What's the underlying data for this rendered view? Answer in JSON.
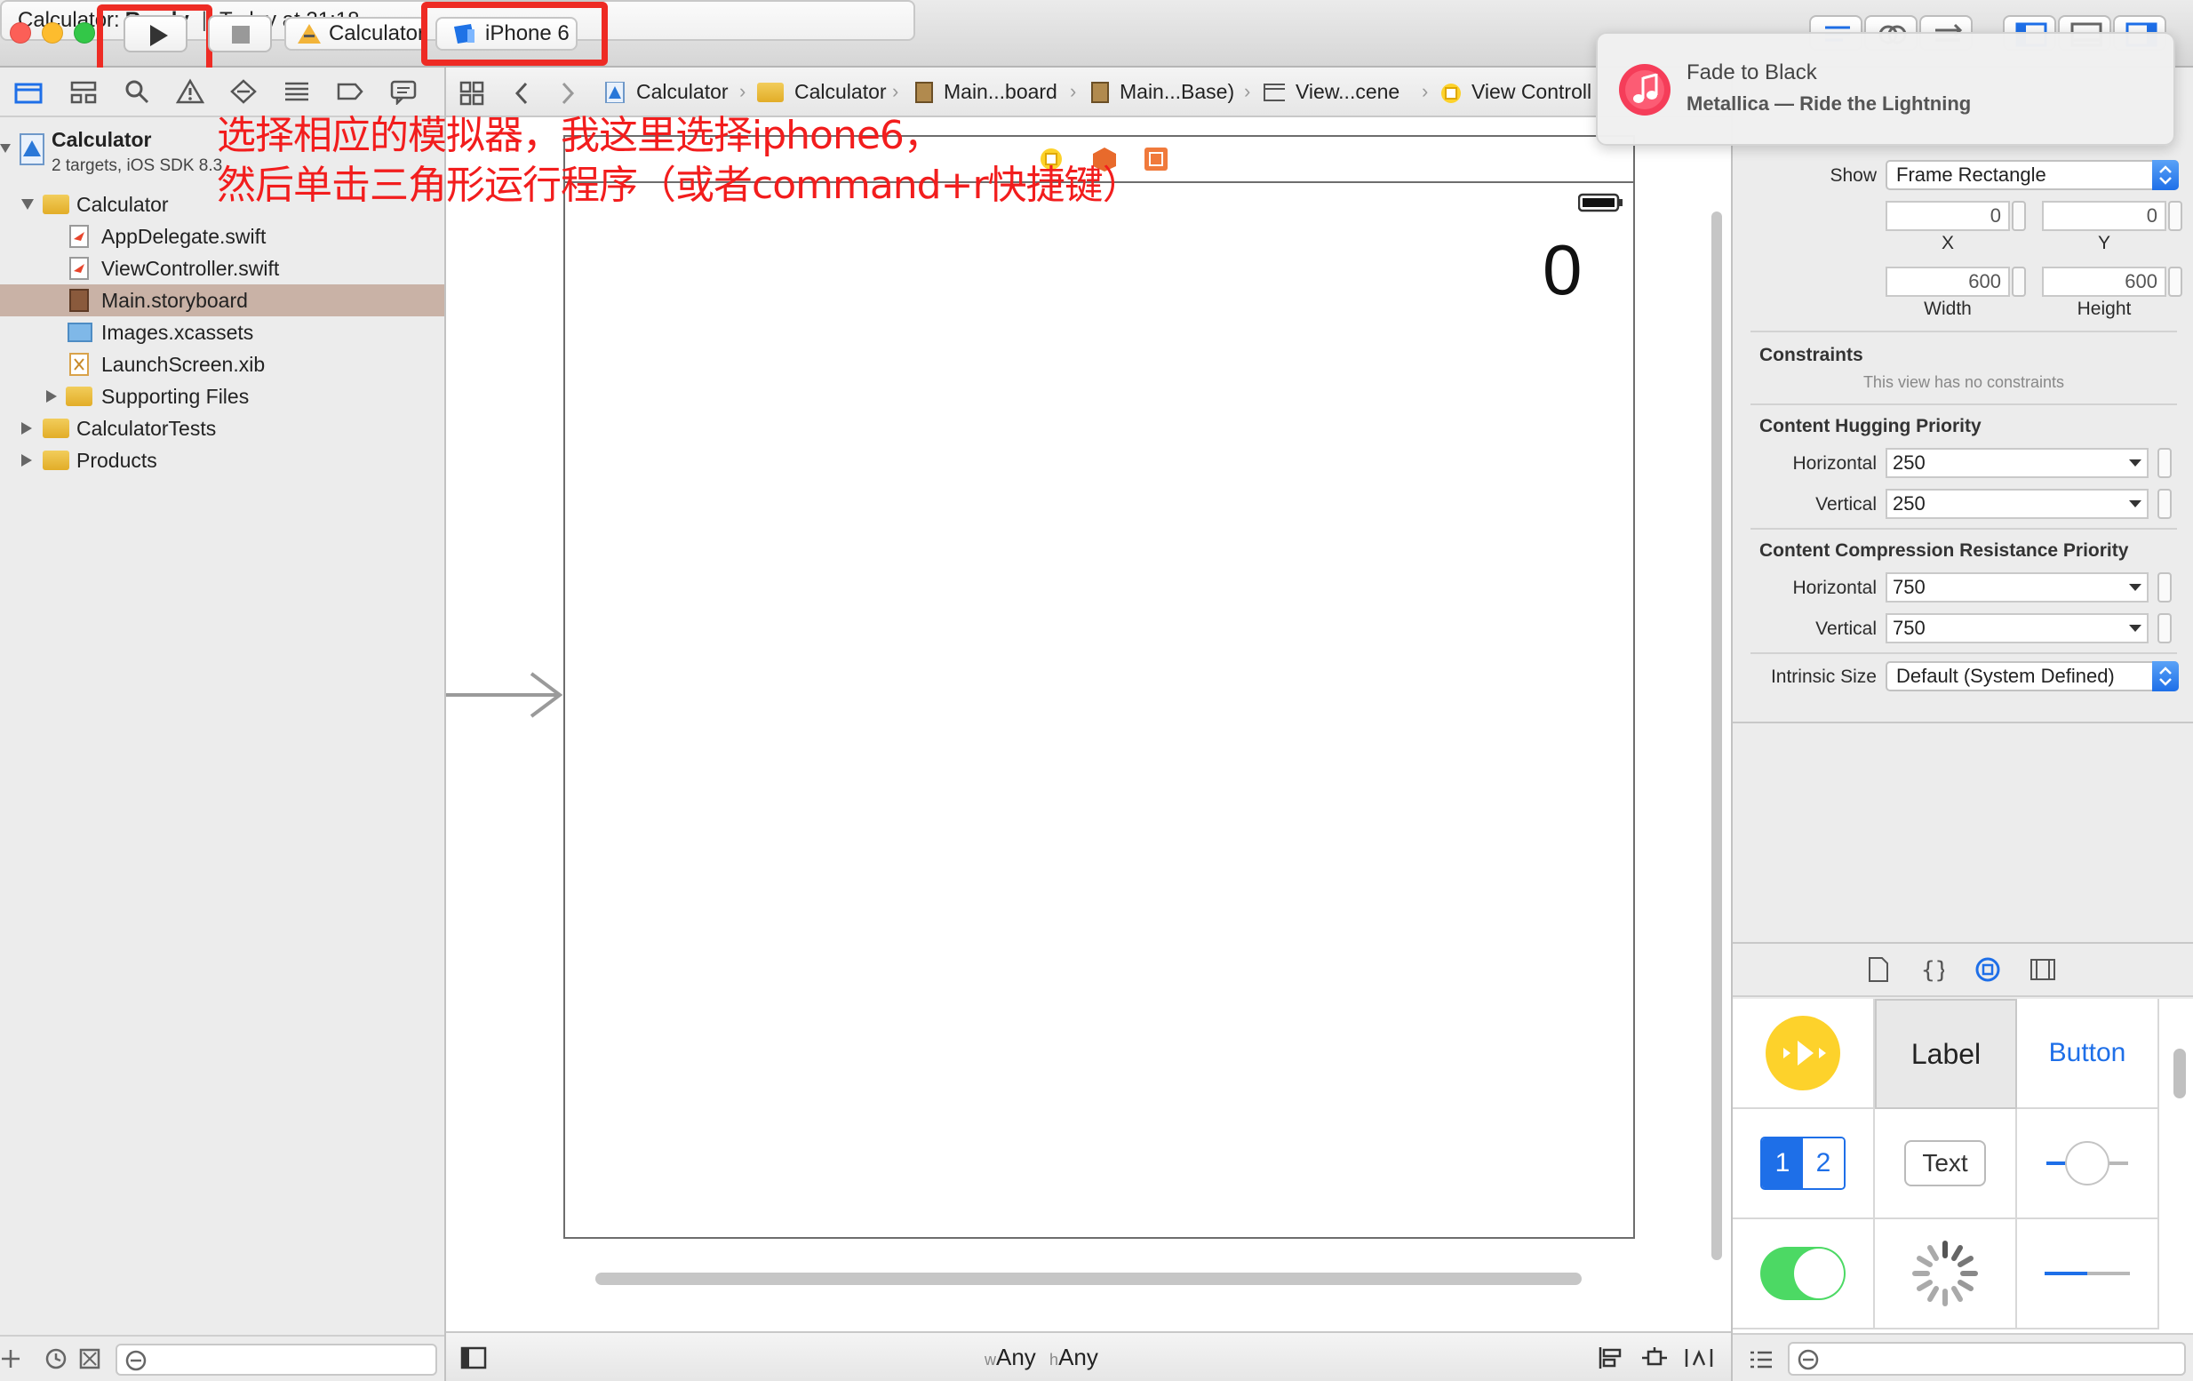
{
  "toolbar": {
    "scheme_name": "Calculator",
    "device_name": "iPhone 6",
    "activity_project": "Calculator: ",
    "activity_status": "Ready",
    "activity_separator": "|",
    "activity_time": "Today at 21:18"
  },
  "notification": {
    "title": "Fade to Black",
    "subtitle": "Metallica — Ride the Lightning"
  },
  "annotation": {
    "line1": "选择相应的模拟器，我这里选择iphone6，",
    "line2": "然后单击三角形运行程序（或者command+r快捷键）"
  },
  "navigator": {
    "project_name": "Calculator",
    "project_detail": "2 targets, iOS SDK 8.3",
    "items": [
      {
        "label": "Calculator",
        "kind": "folder",
        "level": 1
      },
      {
        "label": "AppDelegate.swift",
        "kind": "swift",
        "level": 2
      },
      {
        "label": "ViewController.swift",
        "kind": "swift",
        "level": 2
      },
      {
        "label": "Main.storyboard",
        "kind": "storyboard",
        "level": 2,
        "selected": true
      },
      {
        "label": "Images.xcassets",
        "kind": "assets",
        "level": 2
      },
      {
        "label": "LaunchScreen.xib",
        "kind": "xib",
        "level": 2
      },
      {
        "label": "Supporting Files",
        "kind": "folder",
        "level": 2
      },
      {
        "label": "CalculatorTests",
        "kind": "folder",
        "level": 1
      },
      {
        "label": "Products",
        "kind": "folder",
        "level": 1
      }
    ]
  },
  "jumpbar": {
    "crumbs": [
      "Calculator",
      "Calculator",
      "Main...board",
      "Main...Base)",
      "View...cene",
      "View Controll"
    ]
  },
  "scene": {
    "display_value": "0"
  },
  "editor_bottom": {
    "w_prefix": "w",
    "w_value": "Any",
    "h_prefix": "h",
    "h_value": "Any"
  },
  "inspector": {
    "show_label": "Show",
    "show_value": "Frame Rectangle",
    "x_value": "0",
    "y_value": "0",
    "x_label": "X",
    "y_label": "Y",
    "width_value": "600",
    "height_value": "600",
    "width_label": "Width",
    "height_label": "Height",
    "constraints_title": "Constraints",
    "constraints_note": "This view has no constraints",
    "hugging_title": "Content Hugging Priority",
    "horizontal_label": "Horizontal",
    "vertical_label": "Vertical",
    "hugging_horizontal": "250",
    "hugging_vertical": "250",
    "compression_title": "Content Compression Resistance Priority",
    "compression_horizontal": "750",
    "compression_vertical": "750",
    "intrinsic_label": "Intrinsic Size",
    "intrinsic_value": "Default (System Defined)"
  },
  "library": {
    "label_tile": "Label",
    "button_tile": "Button",
    "segment_1": "1",
    "segment_2": "2",
    "text_tile": "Text"
  },
  "colors": {
    "annotation_red": "#ee2b24",
    "accent_blue": "#1e6fe8",
    "switch_green": "#4cd964",
    "player_yellow": "#fdd22b"
  }
}
